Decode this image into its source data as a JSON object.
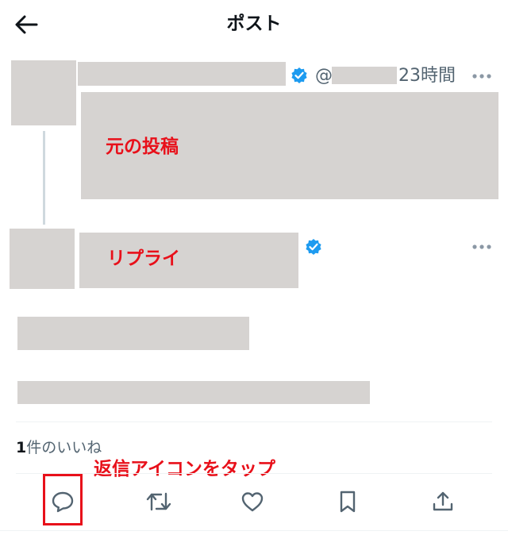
{
  "header": {
    "title": "ポスト"
  },
  "original_post": {
    "handle_prefix": "@",
    "time": "23時間",
    "label": "元の投稿"
  },
  "reply": {
    "label": "リプライ"
  },
  "likes": {
    "count": "1",
    "label": "件のいいね"
  },
  "annotation": {
    "text": "返信アイコンをタップ"
  },
  "colors": {
    "accent": "#1d9bf0",
    "annotation": "#e8101a",
    "placeholder": "#d6d3d1"
  },
  "icons": [
    "arrow-left-icon",
    "verified-badge-icon",
    "more-icon",
    "reply-icon",
    "repost-icon",
    "like-icon",
    "bookmark-icon",
    "share-icon"
  ]
}
